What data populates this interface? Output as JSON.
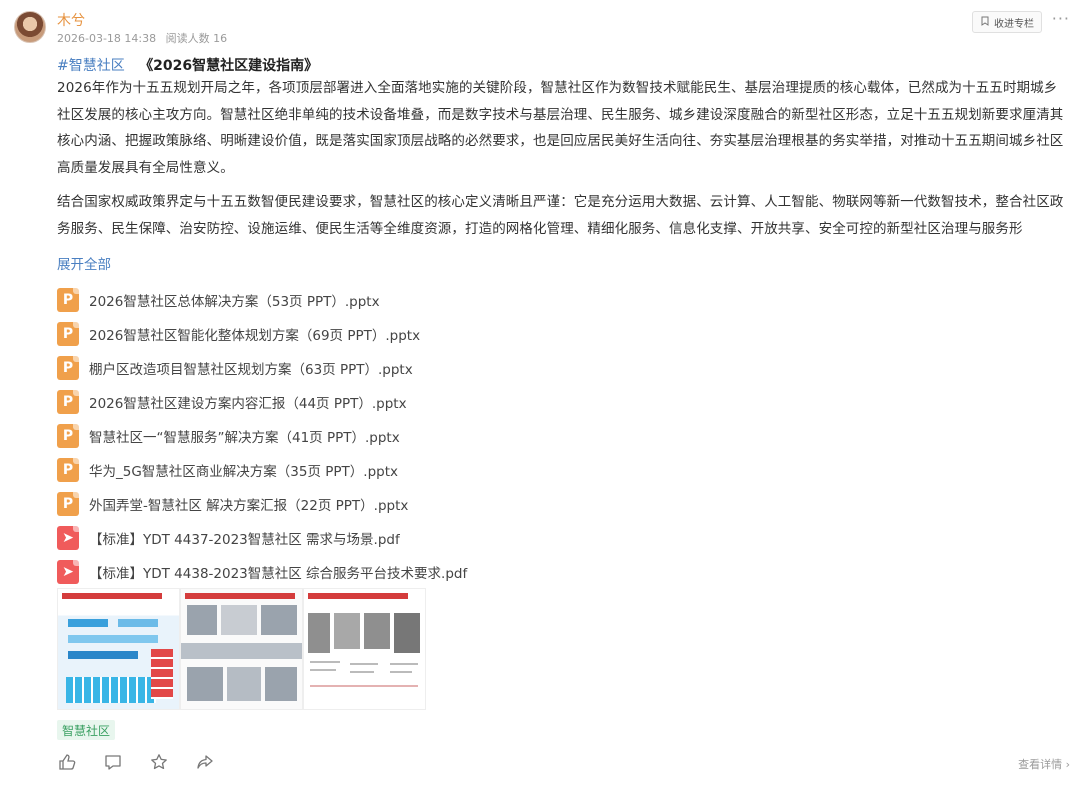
{
  "post": {
    "author": "木兮",
    "date": "2026-03-18 14:38",
    "reads": "阅读人数 16",
    "collect_label": "收进专栏",
    "more_label": "···",
    "hashtag": "#智慧社区",
    "book_title": "《2026智慧社区建设指南》",
    "paragraph1": "2026年作为十五五规划开局之年，各项顶层部署进入全面落地实施的关键阶段，智慧社区作为数智技术赋能民生、基层治理提质的核心载体，已然成为十五五时期城乡社区发展的核心主攻方向。智慧社区绝非单纯的技术设备堆叠，而是数字技术与基层治理、民生服务、城乡建设深度融合的新型社区形态，立足十五五规划新要求厘清其核心内涵、把握政策脉络、明晰建设价值，既是落实国家顶层战略的必然要求，也是回应居民美好生活向往、夯实基层治理根基的务实举措，对推动十五五期间城乡社区高质量发展具有全局性意义。",
    "paragraph2": "结合国家权威政策界定与十五五数智便民建设要求，智慧社区的核心定义清晰且严谨：它是充分运用大数据、云计算、人工智能、物联网等新一代数智技术，整合社区政务服务、民生保障、治安防控、设施运维、便民生活等全维度资源，打造的网格化管理、精细化服务、信息化支撑、开放共享、安全可控的新型社区治理与服务形",
    "expand_label": "展开全部",
    "files": [
      {
        "type": "ppt",
        "icon": "ppt-file-icon",
        "glyph": "P",
        "name": "2026智慧社区总体解决方案（53页 PPT）.pptx"
      },
      {
        "type": "ppt",
        "icon": "ppt-file-icon",
        "glyph": "P",
        "name": "2026智慧社区智能化整体规划方案（69页 PPT）.pptx"
      },
      {
        "type": "ppt",
        "icon": "ppt-file-icon",
        "glyph": "P",
        "name": "棚户区改造项目智慧社区规划方案（63页 PPT）.pptx"
      },
      {
        "type": "ppt",
        "icon": "ppt-file-icon",
        "glyph": "P",
        "name": "2026智慧社区建设方案内容汇报（44页 PPT）.pptx"
      },
      {
        "type": "ppt",
        "icon": "ppt-file-icon",
        "glyph": "P",
        "name": "智慧社区一“智慧服务”解决方案（41页 PPT）.pptx"
      },
      {
        "type": "ppt",
        "icon": "ppt-file-icon",
        "glyph": "P",
        "name": "华为_5G智慧社区商业解决方案（35页 PPT）.pptx"
      },
      {
        "type": "ppt",
        "icon": "ppt-file-icon",
        "glyph": "P",
        "name": "外国弄堂-智慧社区 解决方案汇报（22页 PPT）.pptx"
      },
      {
        "type": "pdf",
        "icon": "pdf-file-icon",
        "glyph": "➤",
        "name": "【标准】YDT 4437-2023智慧社区 需求与场景.pdf"
      },
      {
        "type": "pdf",
        "icon": "pdf-file-icon",
        "glyph": "➤",
        "name": "【标准】YDT 4438-2023智慧社区 综合服务平台技术要求.pdf"
      }
    ],
    "topic_tag": "智慧社区",
    "detail_link": "查看详情 ›"
  },
  "colors": {
    "accent_blue": "#4a7fc1",
    "author_orange": "#e6913d",
    "ppt_orange": "#f0a04b",
    "pdf_red": "#f05b5b",
    "tag_green": "#3aa062"
  },
  "icons": {
    "collect": "bookmark-plus-icon",
    "like": "thumbs-up-icon",
    "comment": "comment-icon",
    "favorite": "star-icon",
    "share": "share-icon"
  }
}
